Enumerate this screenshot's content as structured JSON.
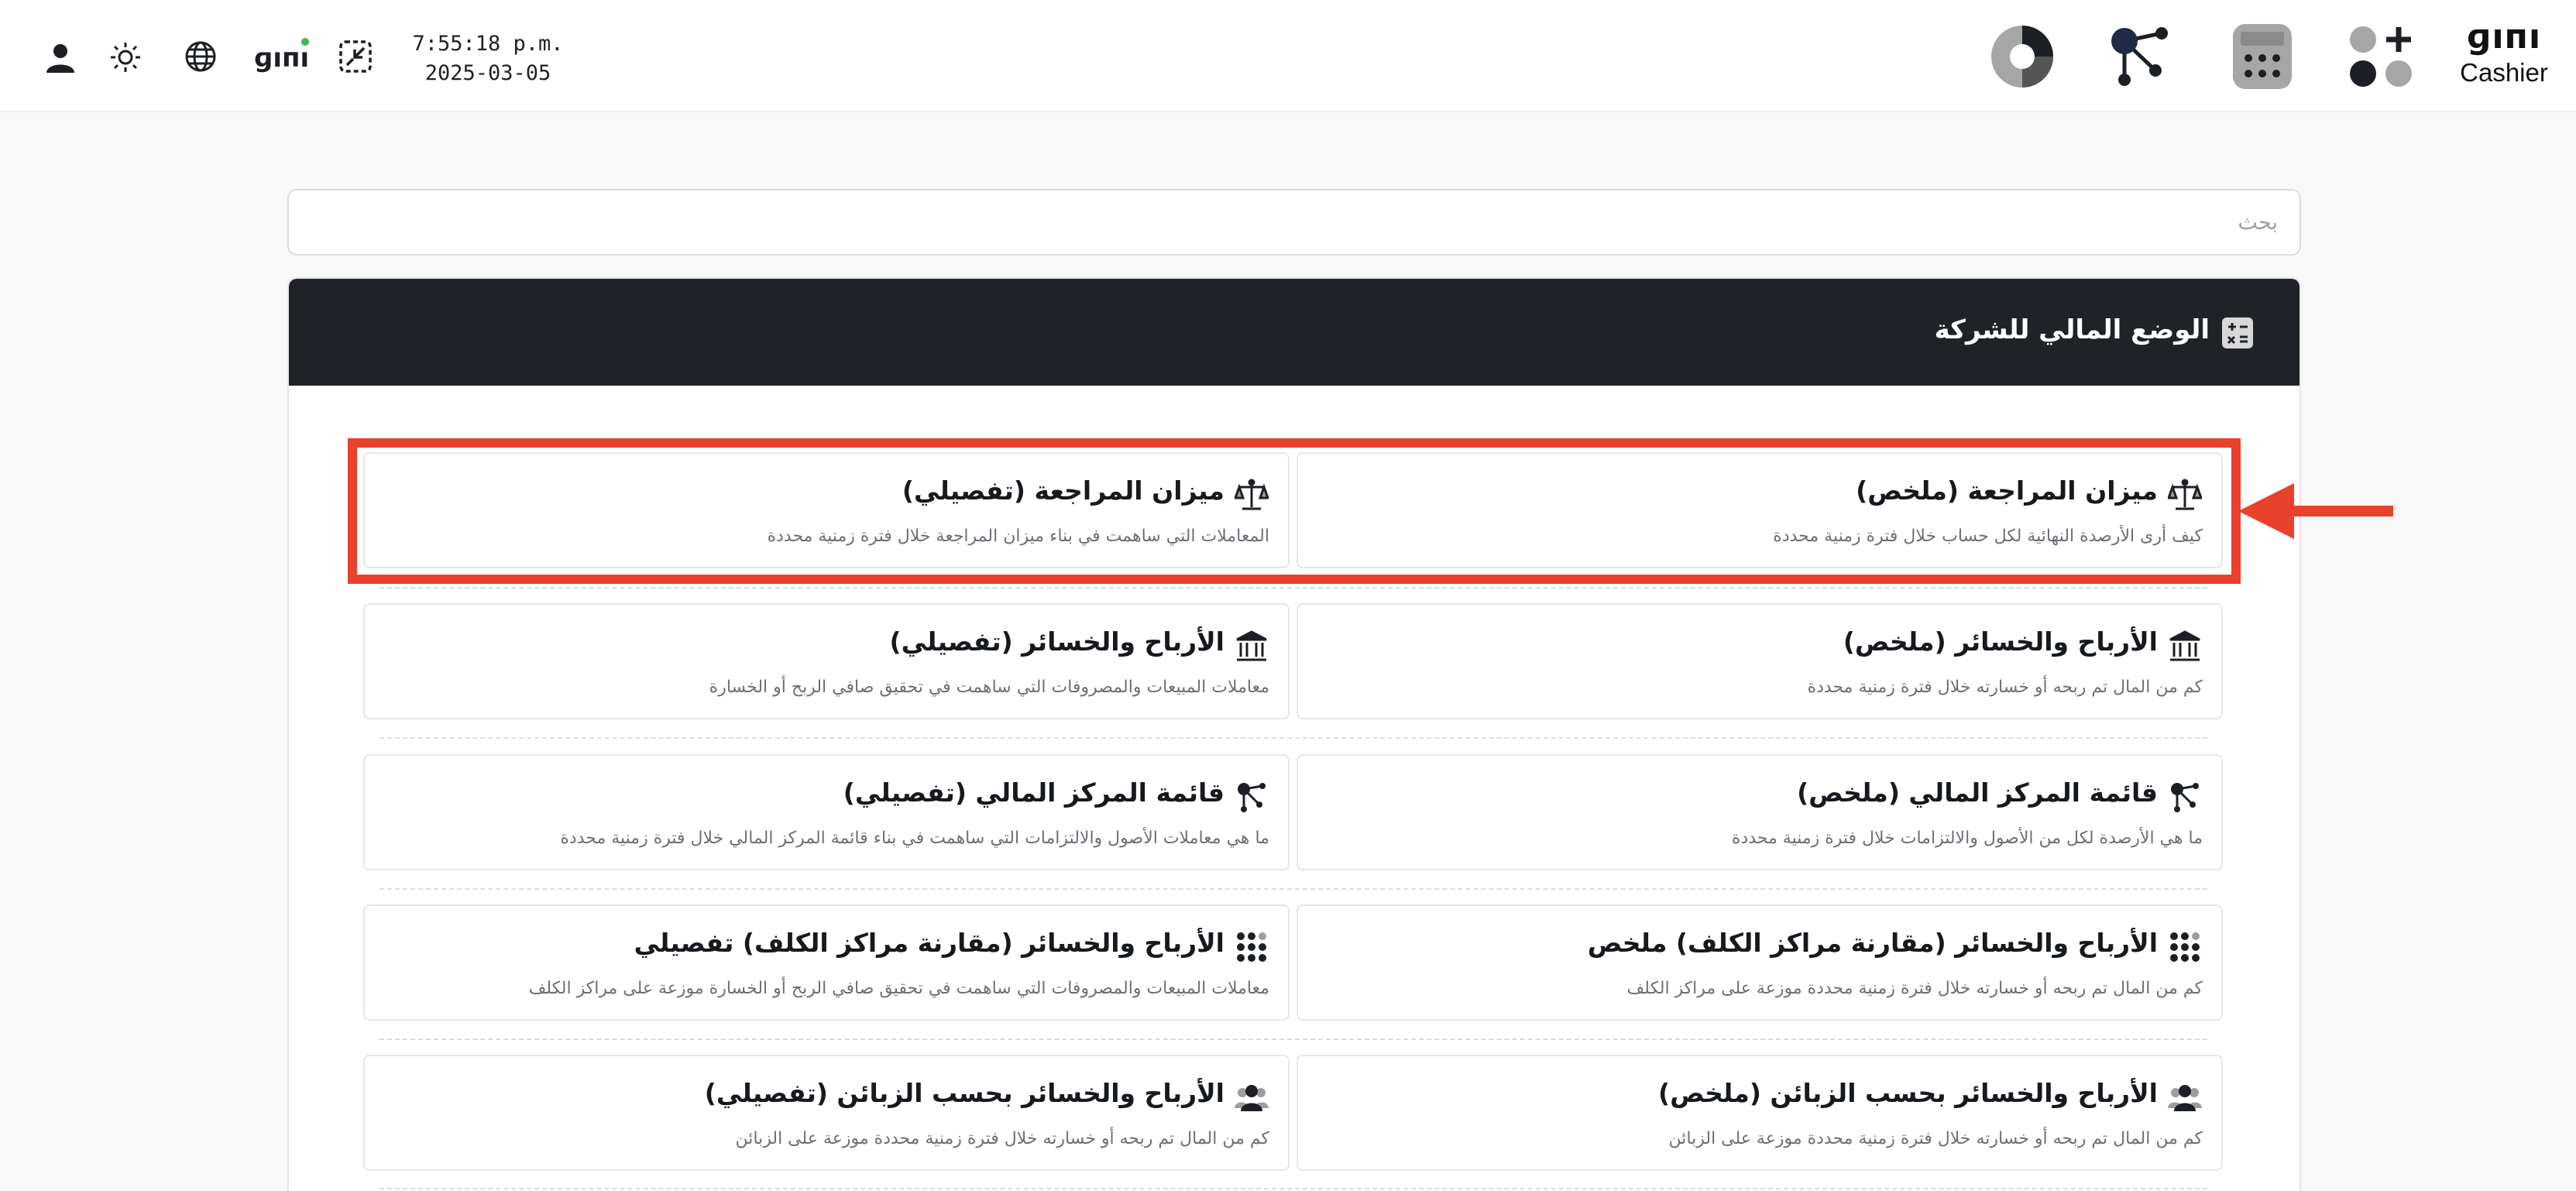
{
  "topbar": {
    "clock": {
      "time": "7:55:18 p.m.",
      "date": "2025-03-05"
    },
    "left_icons": [
      "user-icon",
      "sun-icon",
      "globe-icon",
      "gini-logo-icon",
      "collapse-icon"
    ],
    "right_apps": [
      "pie-chart-icon",
      "graph-nodes-icon",
      "calculator-icon",
      "apps-add-icon"
    ],
    "brand": {
      "mark": "ɡıпı",
      "name": "Cashier"
    }
  },
  "search": {
    "placeholder": "بحث"
  },
  "panel": {
    "title": "الوضع المالي للشركة",
    "title_icon": "calculator-icon"
  },
  "reports": [
    {
      "row": 0,
      "side": "right",
      "icon": "scale-icon",
      "title": "ميزان المراجعة (ملخص)",
      "description": "كيف أرى الأرصدة النهائية لكل حساب خلال فترة زمنية محددة"
    },
    {
      "row": 0,
      "side": "left",
      "icon": "scale-icon",
      "title": "ميزان المراجعة (تفصيلي)",
      "description": "المعاملات التي ساهمت في بناء ميزان المراجعة خلال فترة زمنية محددة"
    },
    {
      "row": 1,
      "side": "right",
      "icon": "bank-icon",
      "title": "الأرباح والخسائر (ملخص)",
      "description": "كم من المال تم ربحه أو خسارته خلال فترة زمنية محددة"
    },
    {
      "row": 1,
      "side": "left",
      "icon": "bank-icon",
      "title": "الأرباح والخسائر (تفصيلي)",
      "description": "معاملات المبيعات والمصروفات التي ساهمت في تحقيق صافي الربح أو الخسارة"
    },
    {
      "row": 2,
      "side": "right",
      "icon": "nodes-icon",
      "title": "قائمة المركز المالي (ملخص)",
      "description": "ما هي الأرصدة لكل من الأصول والالتزامات خلال فترة زمنية محددة"
    },
    {
      "row": 2,
      "side": "left",
      "icon": "nodes-icon",
      "title": "قائمة المركز المالي (تفصيلي)",
      "description": "ما هي معاملات الأصول والالتزامات التي ساهمت في بناء قائمة المركز المالي خلال فترة زمنية محددة"
    },
    {
      "row": 3,
      "side": "right",
      "icon": "dots-grid-icon",
      "title": "الأرباح والخسائر (مقارنة مراكز الكلف) ملخص",
      "description": "كم من المال تم ربحه أو خسارته خلال فترة زمنية محددة موزعة على مراكز الكلف"
    },
    {
      "row": 3,
      "side": "left",
      "icon": "dots-grid-icon",
      "title": "الأرباح والخسائر (مقارنة مراكز الكلف) تفصيلي",
      "description": "معاملات المبيعات والمصروفات التي ساهمت في تحقيق صافي الربح أو الخسارة موزعة على مراكز الكلف"
    },
    {
      "row": 4,
      "side": "right",
      "icon": "customers-icon",
      "title": "الأرباح والخسائر بحسب الزبائن (ملخص)",
      "description": "كم من المال تم ربحه أو خسارته خلال فترة زمنية محددة موزعة على الزبائن"
    },
    {
      "row": 4,
      "side": "left",
      "icon": "customers-icon",
      "title": "الأرباح والخسائر بحسب الزبائن (تفصيلي)",
      "description": "كم من المال تم ربحه أو خسارته خلال فترة زمنية محددة موزعة على الزبائن"
    }
  ],
  "annotation": {
    "color": "#e8412c",
    "highlighted_row": 0
  },
  "colors": {
    "header_bg": "#1f2328",
    "page_bg": "#f8f8f8",
    "accent": "#e8412c",
    "status_dot": "#4caf50"
  }
}
